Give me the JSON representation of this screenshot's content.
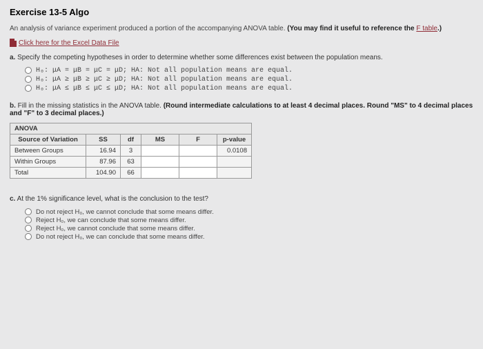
{
  "title": "Exercise 13-5 Algo",
  "intro": {
    "text1": "An analysis of variance experiment produced a portion of the accompanying ANOVA table.",
    "bold": "(You may find it useful to reference the ",
    "link": "F table",
    "bold2": ".)"
  },
  "file_link": "Click here for the Excel Data File",
  "part_a": {
    "label": "a.",
    "text": "Specify the competing hypotheses in order to determine whether some differences exist between the population means."
  },
  "hyp_options": [
    "H₀: μA = μB = μC = μD; HA: Not all population means are equal.",
    "H₀: μA ≥ μB ≥ μC ≥ μD; HA: Not all population means are equal.",
    "H₀: μA ≤ μB ≤ μC ≤ μD; HA: Not all population means are equal."
  ],
  "part_b": {
    "label": "b.",
    "text": "Fill in the missing statistics in the ANOVA table.",
    "bold": "(Round intermediate calculations to at least 4 decimal places. Round \"MS\" to 4 decimal places and \"F\" to 3 decimal places.)"
  },
  "anova": {
    "title": "ANOVA",
    "headers": [
      "Source of Variation",
      "SS",
      "df",
      "MS",
      "F",
      "p-value"
    ],
    "rows": [
      {
        "label": "Between Groups",
        "ss": "16.94",
        "df": "3",
        "ms": "",
        "f": "",
        "p": "0.0108"
      },
      {
        "label": "Within Groups",
        "ss": "87.96",
        "df": "63",
        "ms": "",
        "f": "",
        "p": ""
      },
      {
        "label": "Total",
        "ss": "104.90",
        "df": "66",
        "ms": "",
        "f": "",
        "p": ""
      }
    ]
  },
  "part_c": {
    "label": "c.",
    "text": "At the 1% significance level, what is the conclusion to the test?"
  },
  "conc_options": [
    "Do not reject H₀, we cannot conclude that some means differ.",
    "Reject H₀, we can conclude that some means differ.",
    "Reject H₀, we cannot conclude that some means differ.",
    "Do not reject H₀, we can conclude that some means differ."
  ]
}
